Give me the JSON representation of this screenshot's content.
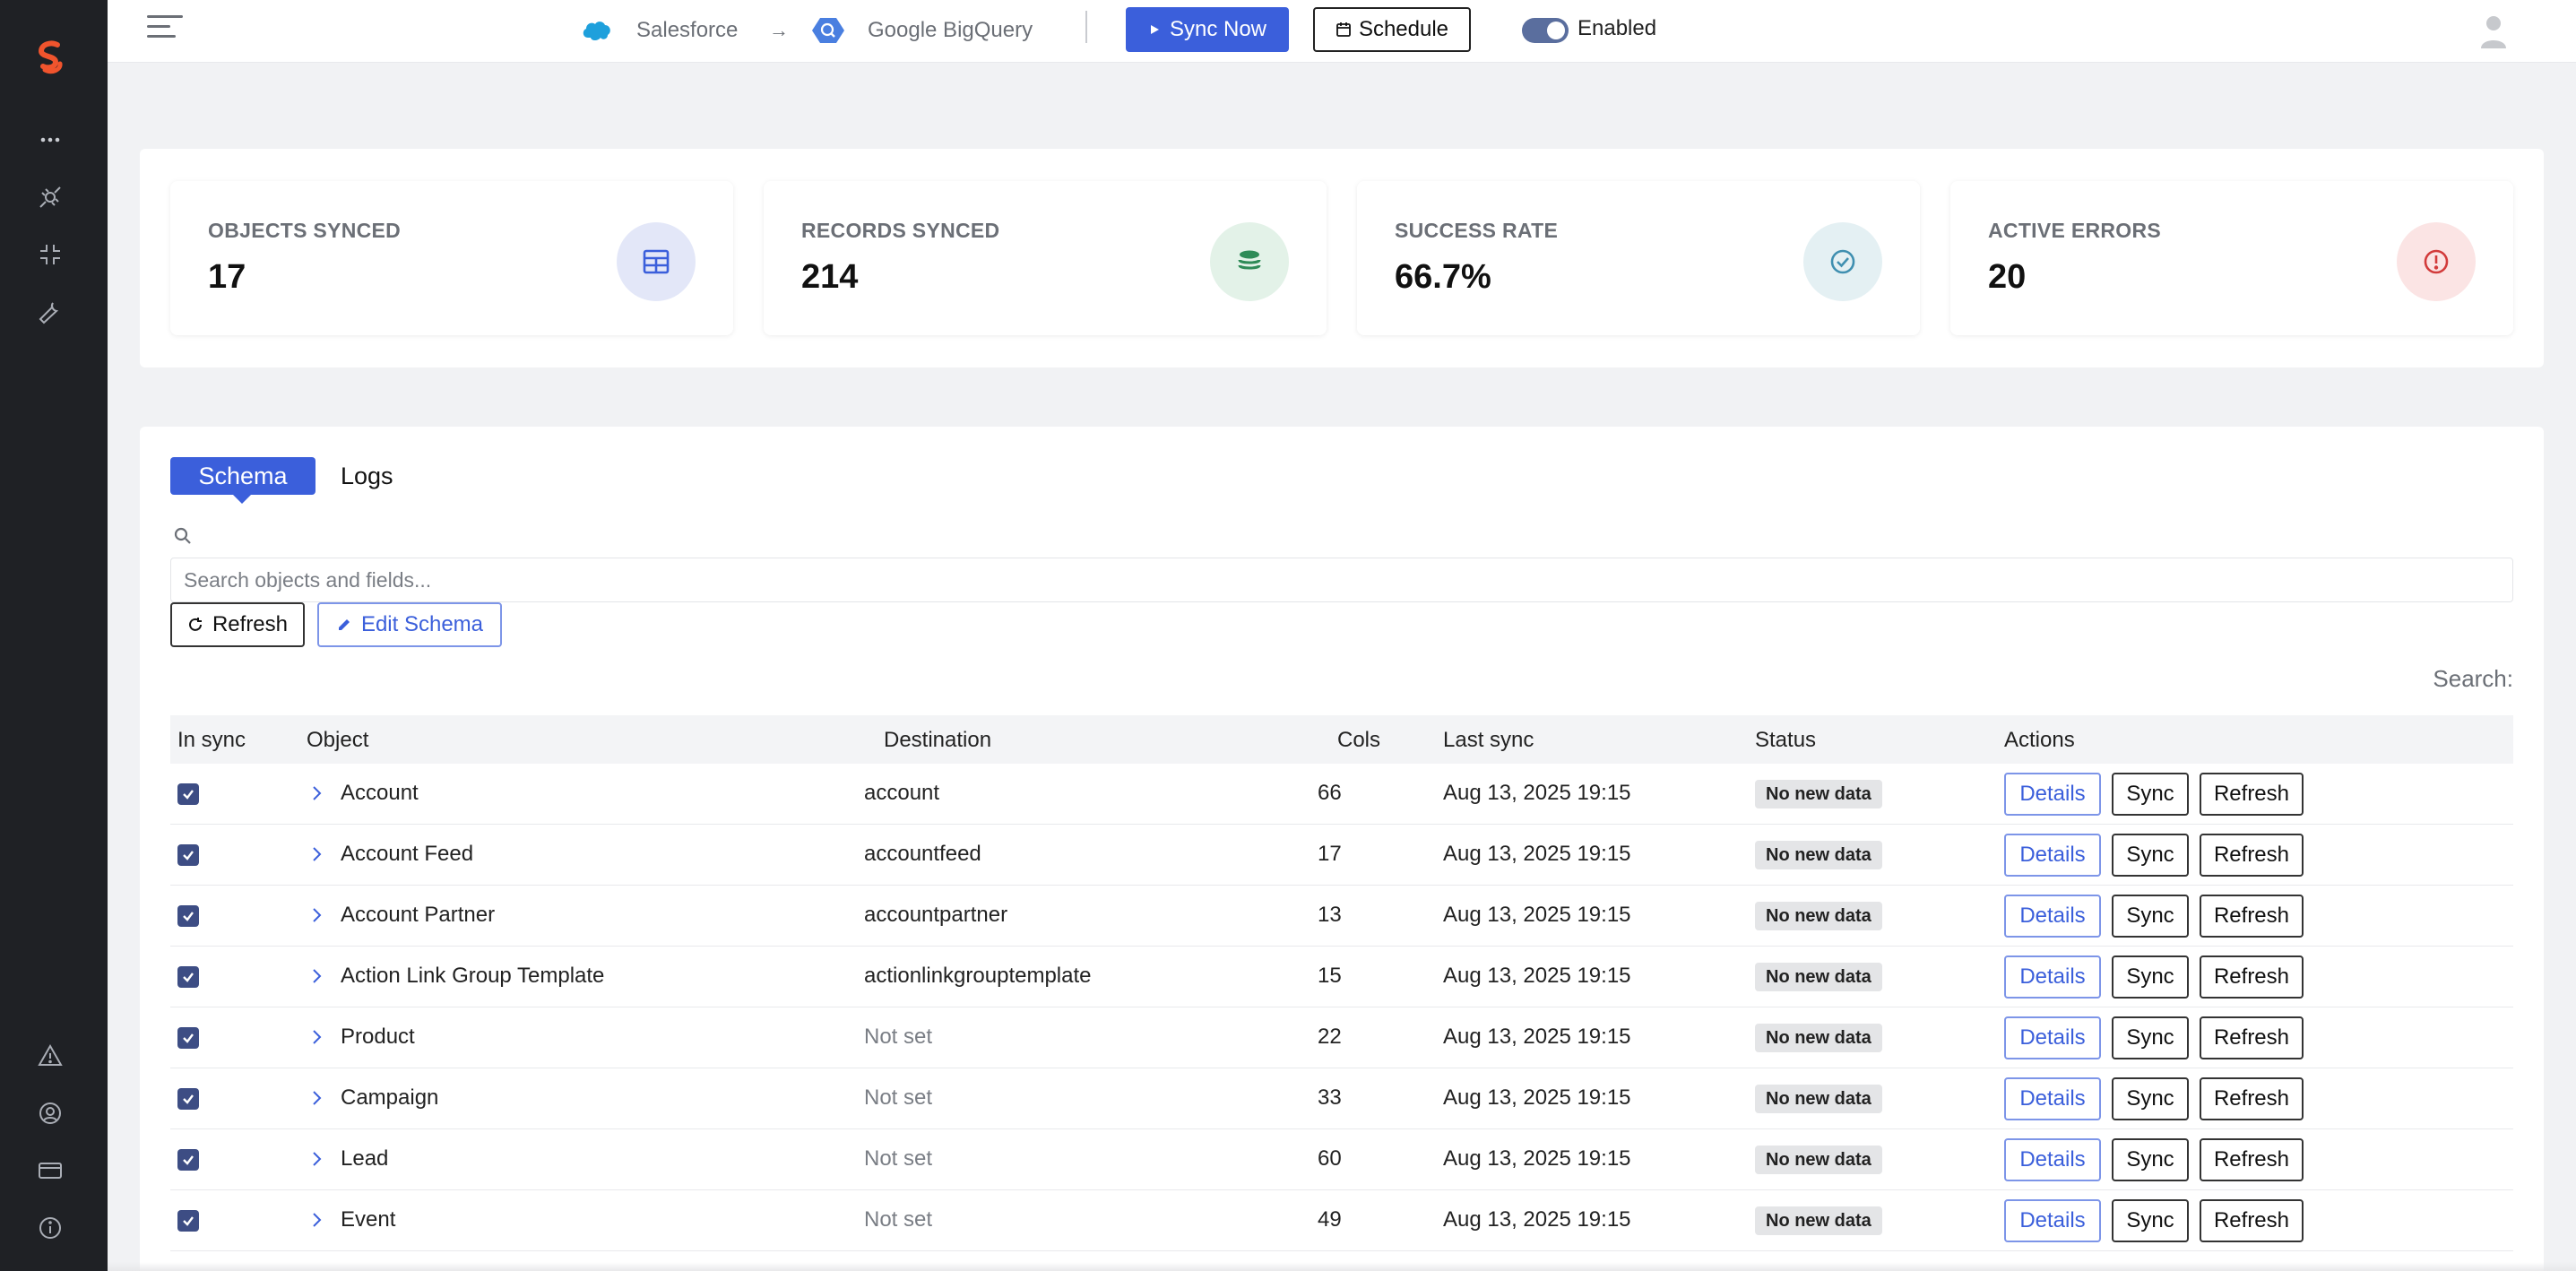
{
  "brand": {
    "logo_icon": "stacksync-s-logo",
    "accent": "#3b5fdb",
    "sidebar_bg": "#1f2125"
  },
  "sidebar": {
    "top_icons": [
      "more-horizontal-icon",
      "plug-disconnected-icon",
      "collapse-icon",
      "wrench-icon"
    ],
    "bottom_icons": [
      "alert-triangle-icon",
      "user-circle-icon",
      "credit-card-icon",
      "info-icon"
    ]
  },
  "topbar": {
    "source": "Salesforce",
    "arrow": "→",
    "destination": "Google BigQuery",
    "sync_now_label": "Sync Now",
    "schedule_label": "Schedule",
    "enabled_label": "Enabled",
    "enabled": true
  },
  "stats": [
    {
      "label": "OBJECTS SYNCED",
      "value": "17",
      "icon": "table-icon",
      "color": "#3b5fdb",
      "bg": "#e3e7f8"
    },
    {
      "label": "RECORDS SYNCED",
      "value": "214",
      "icon": "database-stack-icon",
      "color": "#2e8b57",
      "bg": "#e3f2e8"
    },
    {
      "label": "SUCCESS RATE",
      "value": "66.7%",
      "icon": "check-circle-icon",
      "color": "#3f8fb0",
      "bg": "#e4f0f3"
    },
    {
      "label": "ACTIVE ERRORS",
      "value": "20",
      "icon": "alert-circle-icon",
      "color": "#d23b3b",
      "bg": "#fbe4e4"
    }
  ],
  "tabs": {
    "schema": "Schema",
    "logs": "Logs"
  },
  "search": {
    "placeholder": "Search objects and fields...",
    "label": "Search:"
  },
  "actions": {
    "refresh_label": "Refresh",
    "edit_schema_label": "Edit Schema"
  },
  "table": {
    "headers": {
      "in_sync": "In sync",
      "object": "Object",
      "destination": "Destination",
      "cols": "Cols",
      "last_sync": "Last sync",
      "status": "Status",
      "actions": "Actions"
    },
    "row_buttons": {
      "details": "Details",
      "sync": "Sync",
      "refresh": "Refresh"
    },
    "rows": [
      {
        "in_sync": true,
        "object": "Account",
        "destination": "account",
        "dest_set": true,
        "cols": "66",
        "last_sync": "Aug 13, 2025 19:15",
        "status": "No new data"
      },
      {
        "in_sync": true,
        "object": "Account Feed",
        "destination": "accountfeed",
        "dest_set": true,
        "cols": "17",
        "last_sync": "Aug 13, 2025 19:15",
        "status": "No new data"
      },
      {
        "in_sync": true,
        "object": "Account Partner",
        "destination": "accountpartner",
        "dest_set": true,
        "cols": "13",
        "last_sync": "Aug 13, 2025 19:15",
        "status": "No new data"
      },
      {
        "in_sync": true,
        "object": "Action Link Group Template",
        "destination": "actionlinkgrouptemplate",
        "dest_set": true,
        "cols": "15",
        "last_sync": "Aug 13, 2025 19:15",
        "status": "No new data"
      },
      {
        "in_sync": true,
        "object": "Product",
        "destination": "Not set",
        "dest_set": false,
        "cols": "22",
        "last_sync": "Aug 13, 2025 19:15",
        "status": "No new data"
      },
      {
        "in_sync": true,
        "object": "Campaign",
        "destination": "Not set",
        "dest_set": false,
        "cols": "33",
        "last_sync": "Aug 13, 2025 19:15",
        "status": "No new data"
      },
      {
        "in_sync": true,
        "object": "Lead",
        "destination": "Not set",
        "dest_set": false,
        "cols": "60",
        "last_sync": "Aug 13, 2025 19:15",
        "status": "No new data"
      },
      {
        "in_sync": true,
        "object": "Event",
        "destination": "Not set",
        "dest_set": false,
        "cols": "49",
        "last_sync": "Aug 13, 2025 19:15",
        "status": "No new data"
      }
    ]
  }
}
